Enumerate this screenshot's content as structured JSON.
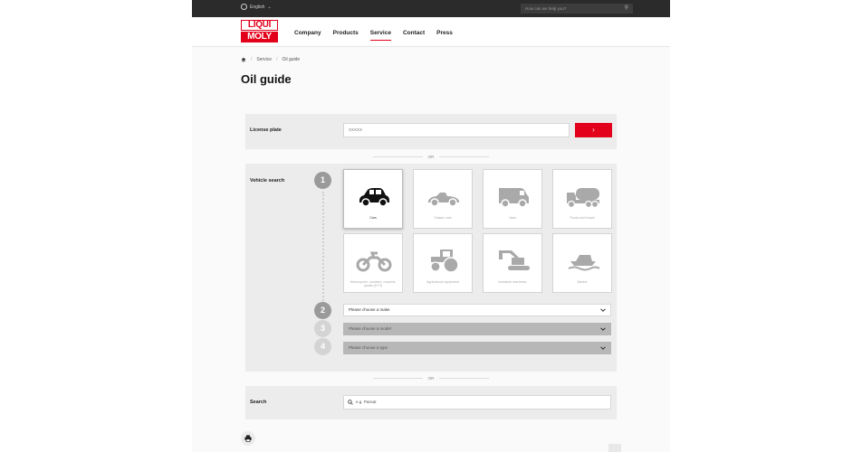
{
  "topbar": {
    "language": "English",
    "search_placeholder": "How can we help you?"
  },
  "logo": {
    "line1": "LIQUI",
    "line2": "MOLY"
  },
  "nav": {
    "items": [
      {
        "label": "Company"
      },
      {
        "label": "Products"
      },
      {
        "label": "Service",
        "active": true
      },
      {
        "label": "Contact"
      },
      {
        "label": "Press"
      }
    ]
  },
  "breadcrumb": {
    "items": [
      "Service",
      "Oil guide"
    ]
  },
  "page": {
    "title": "Oil guide"
  },
  "license_plate": {
    "label": "License plate",
    "value": "XXXXX",
    "button": "›"
  },
  "divider": {
    "or": "OR"
  },
  "vehicle_search": {
    "label": "Vehicle search",
    "steps": [
      "1",
      "2",
      "3",
      "4"
    ],
    "categories": [
      {
        "label": "Cars",
        "icon": "car-icon",
        "selected": true
      },
      {
        "label": "Classic cars",
        "icon": "classic-car-icon"
      },
      {
        "label": "Vans",
        "icon": "van-icon"
      },
      {
        "label": "Trucks and buses",
        "icon": "truck-icon"
      },
      {
        "label": "Motorcycles, scooters, mopeds, quads (UTV)",
        "icon": "motorcycle-icon"
      },
      {
        "label": "Agricultural equipment",
        "icon": "tractor-icon"
      },
      {
        "label": "Industrial machines",
        "icon": "excavator-icon"
      },
      {
        "label": "Marine",
        "icon": "boat-icon"
      }
    ],
    "make": "Please choose a make",
    "model": "Please choose a model",
    "type": "Please choose a type"
  },
  "search": {
    "label": "Search",
    "placeholder": "e.g. Passat"
  },
  "colors": {
    "brand_red": "#e2001a",
    "step_active": "#9a9a9a",
    "step_inactive": "#d4d4d4"
  }
}
